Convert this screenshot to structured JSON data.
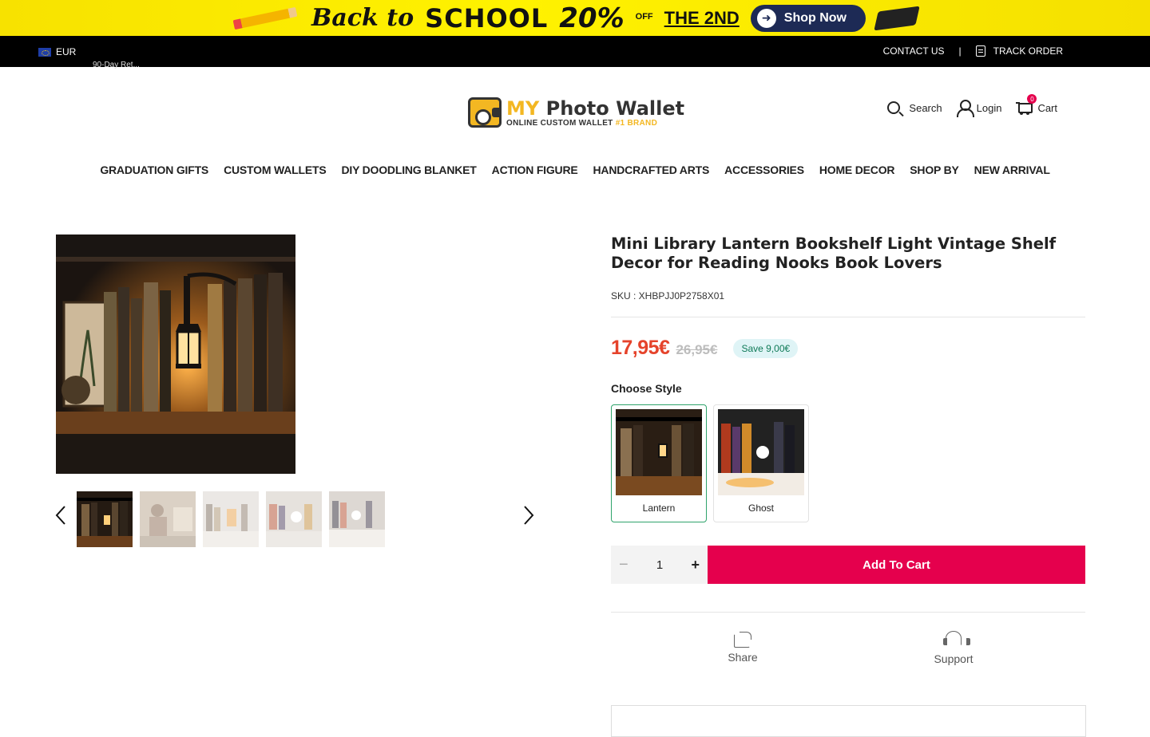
{
  "promo": {
    "text_back": "Back to",
    "text_school": "SCHOOL",
    "text_pct": "20%",
    "text_off": "OFF",
    "text_2nd": "THE 2ND",
    "shop_now": "Shop Now"
  },
  "topbar": {
    "currency": "EUR",
    "ticker": "90-Day Ret...",
    "contact": "CONTACT US",
    "separator": "|",
    "track": "TRACK ORDER"
  },
  "logo": {
    "my": "MY",
    "name": "Photo Wallet",
    "tagline": "ONLINE CUSTOM WALLET",
    "brand": "#1 BRAND"
  },
  "header": {
    "search": "Search",
    "login": "Login",
    "cart": "Cart",
    "cart_count": "0"
  },
  "nav": {
    "items": [
      "GRADUATION GIFTS",
      "CUSTOM WALLETS",
      "DIY DOODLING BLANKET",
      "ACTION FIGURE",
      "HANDCRAFTED ARTS",
      "ACCESSORIES",
      "HOME DECOR",
      "SHOP BY",
      "NEW ARRIVAL"
    ]
  },
  "product": {
    "title": "Mini Library Lantern Bookshelf Light Vintage Shelf Decor for Reading Nooks Book Lovers",
    "sku": "SKU : XHBPJJ0P2758X01",
    "price": "17,95€",
    "old_price": "26,95€",
    "save": "Save 9,00€",
    "style_label": "Choose Style",
    "styles": [
      {
        "label": "Lantern",
        "selected": true
      },
      {
        "label": "Ghost",
        "selected": false
      }
    ],
    "quantity": "1",
    "minus": "−",
    "plus": "+",
    "add_to_cart": "Add To Cart",
    "share": "Share",
    "support": "Support"
  },
  "colors": {
    "accent": "#e5004d",
    "price": "#e5432b",
    "promo_yellow": "#fff200",
    "selected_border": "#2fa36b"
  }
}
